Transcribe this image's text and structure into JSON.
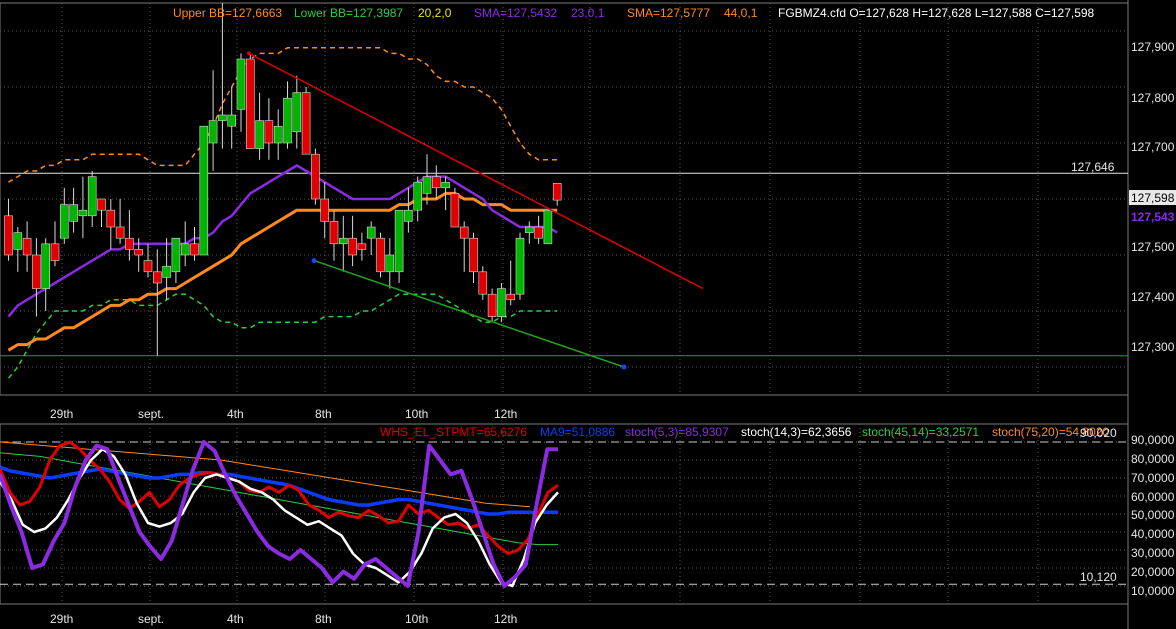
{
  "instrument": "FGBMZ4.cfd",
  "colors": {
    "background": "#000000",
    "grid": "#5a5a5a",
    "bull_candle": "#00b400",
    "bear_candle": "#e00000",
    "upper_bb": "#ff8a1e",
    "lower_bb": "#2ecc40",
    "sma23": "#8a2be2",
    "sma44": "#ff8a1e",
    "trendline_down": "#e00000",
    "trendline_support": "#1fa31f",
    "horizontal_level": "#1fa31f",
    "whs": "#e00000",
    "ma9": "#0a3cff",
    "stoch53": "#8a2be2",
    "stoch143": "#ffffff",
    "stoch4514": "#2ecc40",
    "stoch7520": "#ff8a1e"
  },
  "price_panel": {
    "legend": {
      "upper_bb": "Upper BB=127,6663",
      "lower_bb": "Lower BB=127,3987",
      "bb_params": "20,2,0",
      "sma1": "SMA=127,5432",
      "sma1_params": "23,0,1",
      "sma2": "SMA=127,5777",
      "sma2_params": "44,0,1",
      "ohlc": "FGBMZ4.cfd O=127,628 H=127,628 L=127,588 C=127,598"
    },
    "axis_labels": [
      "127,900",
      "127,800",
      "127,700",
      "127,500",
      "127,400",
      "127,300"
    ],
    "level_label": "127,646",
    "last_price_label": "127,598",
    "sma_price_label": "127,543"
  },
  "date_axis": [
    "29th",
    "sept.",
    "4th",
    "8th",
    "10th",
    "12th"
  ],
  "indicator_panel": {
    "legend": {
      "whs": "WHS_EL_STPMT=65,6276",
      "ma9": "MA9=51,0886",
      "stoch53": "stoch(5,3)=85,9307",
      "stoch143": "stoch(14,3)=62,3656",
      "stoch4514": "stoch(45,14)=33,2571",
      "stoch7520": "stoch(75,20)=54,8020"
    },
    "axis_labels": [
      "90,0000",
      "80,0000",
      "70,0000",
      "60,0000",
      "50,0000",
      "40,0000",
      "30,0000",
      "20,0000",
      "10,0000"
    ],
    "upper_level": "90,020",
    "lower_level": "10,120"
  },
  "chart_data": {
    "type": "candlestick",
    "y_range": [
      127.25,
      127.95
    ],
    "candles": [
      {
        "o": 127.57,
        "h": 127.6,
        "l": 127.49,
        "c": 127.5
      },
      {
        "o": 127.51,
        "h": 127.55,
        "l": 127.47,
        "c": 127.54
      },
      {
        "o": 127.53,
        "h": 127.56,
        "l": 127.47,
        "c": 127.5
      },
      {
        "o": 127.5,
        "h": 127.53,
        "l": 127.39,
        "c": 127.44
      },
      {
        "o": 127.44,
        "h": 127.53,
        "l": 127.4,
        "c": 127.52
      },
      {
        "o": 127.52,
        "h": 127.56,
        "l": 127.48,
        "c": 127.49
      },
      {
        "o": 127.53,
        "h": 127.62,
        "l": 127.52,
        "c": 127.59
      },
      {
        "o": 127.56,
        "h": 127.62,
        "l": 127.54,
        "c": 127.59
      },
      {
        "o": 127.57,
        "h": 127.64,
        "l": 127.53,
        "c": 127.58
      },
      {
        "o": 127.57,
        "h": 127.65,
        "l": 127.55,
        "c": 127.64
      },
      {
        "o": 127.6,
        "h": 127.6,
        "l": 127.55,
        "c": 127.58
      },
      {
        "o": 127.58,
        "h": 127.6,
        "l": 127.51,
        "c": 127.55
      },
      {
        "o": 127.55,
        "h": 127.6,
        "l": 127.52,
        "c": 127.53
      },
      {
        "o": 127.53,
        "h": 127.58,
        "l": 127.49,
        "c": 127.51
      },
      {
        "o": 127.51,
        "h": 127.53,
        "l": 127.47,
        "c": 127.5
      },
      {
        "o": 127.49,
        "h": 127.52,
        "l": 127.46,
        "c": 127.47
      },
      {
        "o": 127.47,
        "h": 127.51,
        "l": 127.32,
        "c": 127.45
      },
      {
        "o": 127.46,
        "h": 127.53,
        "l": 127.42,
        "c": 127.48
      },
      {
        "o": 127.47,
        "h": 127.53,
        "l": 127.45,
        "c": 127.53
      },
      {
        "o": 127.5,
        "h": 127.56,
        "l": 127.48,
        "c": 127.52
      },
      {
        "o": 127.52,
        "h": 127.55,
        "l": 127.49,
        "c": 127.5
      },
      {
        "o": 127.5,
        "h": 127.73,
        "l": 127.5,
        "c": 127.73
      },
      {
        "o": 127.7,
        "h": 127.83,
        "l": 127.65,
        "c": 127.74
      },
      {
        "o": 127.74,
        "h": 127.95,
        "l": 127.69,
        "c": 127.75
      },
      {
        "o": 127.73,
        "h": 127.8,
        "l": 127.69,
        "c": 127.75
      },
      {
        "o": 127.76,
        "h": 127.86,
        "l": 127.72,
        "c": 127.85
      },
      {
        "o": 127.85,
        "h": 127.86,
        "l": 127.74,
        "c": 127.69
      },
      {
        "o": 127.69,
        "h": 127.79,
        "l": 127.67,
        "c": 127.74
      },
      {
        "o": 127.74,
        "h": 127.78,
        "l": 127.67,
        "c": 127.7
      },
      {
        "o": 127.7,
        "h": 127.76,
        "l": 127.67,
        "c": 127.73
      },
      {
        "o": 127.7,
        "h": 127.81,
        "l": 127.69,
        "c": 127.78
      },
      {
        "o": 127.72,
        "h": 127.82,
        "l": 127.69,
        "c": 127.79
      },
      {
        "o": 127.79,
        "h": 127.8,
        "l": 127.68,
        "c": 127.68
      },
      {
        "o": 127.68,
        "h": 127.69,
        "l": 127.59,
        "c": 127.6
      },
      {
        "o": 127.6,
        "h": 127.63,
        "l": 127.53,
        "c": 127.56
      },
      {
        "o": 127.56,
        "h": 127.58,
        "l": 127.49,
        "c": 127.52
      },
      {
        "o": 127.52,
        "h": 127.57,
        "l": 127.47,
        "c": 127.53
      },
      {
        "o": 127.53,
        "h": 127.57,
        "l": 127.48,
        "c": 127.5
      },
      {
        "o": 127.52,
        "h": 127.54,
        "l": 127.49,
        "c": 127.51
      },
      {
        "o": 127.53,
        "h": 127.56,
        "l": 127.5,
        "c": 127.55
      },
      {
        "o": 127.53,
        "h": 127.54,
        "l": 127.46,
        "c": 127.47
      },
      {
        "o": 127.47,
        "h": 127.53,
        "l": 127.44,
        "c": 127.5
      },
      {
        "o": 127.47,
        "h": 127.58,
        "l": 127.45,
        "c": 127.58
      },
      {
        "o": 127.56,
        "h": 127.62,
        "l": 127.54,
        "c": 127.58
      },
      {
        "o": 127.58,
        "h": 127.64,
        "l": 127.56,
        "c": 127.63
      },
      {
        "o": 127.61,
        "h": 127.68,
        "l": 127.59,
        "c": 127.64
      },
      {
        "o": 127.64,
        "h": 127.66,
        "l": 127.6,
        "c": 127.62
      },
      {
        "o": 127.62,
        "h": 127.64,
        "l": 127.58,
        "c": 127.63
      },
      {
        "o": 127.61,
        "h": 127.62,
        "l": 127.55,
        "c": 127.55
      },
      {
        "o": 127.55,
        "h": 127.56,
        "l": 127.47,
        "c": 127.53
      },
      {
        "o": 127.53,
        "h": 127.54,
        "l": 127.45,
        "c": 127.47
      },
      {
        "o": 127.47,
        "h": 127.48,
        "l": 127.42,
        "c": 127.43
      },
      {
        "o": 127.43,
        "h": 127.44,
        "l": 127.38,
        "c": 127.39
      },
      {
        "o": 127.39,
        "h": 127.45,
        "l": 127.38,
        "c": 127.44
      },
      {
        "o": 127.43,
        "h": 127.49,
        "l": 127.41,
        "c": 127.42
      },
      {
        "o": 127.43,
        "h": 127.54,
        "l": 127.42,
        "c": 127.53
      },
      {
        "o": 127.54,
        "h": 127.56,
        "l": 127.52,
        "c": 127.55
      },
      {
        "o": 127.55,
        "h": 127.57,
        "l": 127.52,
        "c": 127.53
      },
      {
        "o": 127.52,
        "h": 127.58,
        "l": 127.52,
        "c": 127.58
      },
      {
        "o": 127.628,
        "h": 127.628,
        "l": 127.588,
        "c": 127.598
      }
    ],
    "sma23": [
      127.39,
      127.41,
      127.42,
      127.43,
      127.44,
      127.45,
      127.46,
      127.47,
      127.48,
      127.49,
      127.5,
      127.51,
      127.51,
      127.52,
      127.52,
      127.52,
      127.52,
      127.52,
      127.52,
      127.52,
      127.53,
      127.53,
      127.54,
      127.56,
      127.57,
      127.59,
      127.61,
      127.62,
      127.63,
      127.64,
      127.65,
      127.66,
      127.65,
      127.64,
      127.63,
      127.62,
      127.61,
      127.6,
      127.6,
      127.6,
      127.6,
      127.6,
      127.61,
      127.62,
      127.63,
      127.64,
      127.64,
      127.64,
      127.63,
      127.62,
      127.61,
      127.6,
      127.58,
      127.57,
      127.56,
      127.55,
      127.55,
      127.55,
      127.55,
      127.54
    ],
    "sma44": [
      127.33,
      127.34,
      127.34,
      127.35,
      127.35,
      127.36,
      127.37,
      127.37,
      127.38,
      127.39,
      127.4,
      127.41,
      127.41,
      127.42,
      127.42,
      127.43,
      127.43,
      127.44,
      127.44,
      127.45,
      127.46,
      127.47,
      127.48,
      127.49,
      127.5,
      127.52,
      127.53,
      127.54,
      127.55,
      127.56,
      127.57,
      127.58,
      127.58,
      127.58,
      127.58,
      127.58,
      127.58,
      127.58,
      127.58,
      127.58,
      127.58,
      127.58,
      127.59,
      127.59,
      127.6,
      127.6,
      127.6,
      127.61,
      127.61,
      127.6,
      127.6,
      127.59,
      127.59,
      127.59,
      127.58,
      127.58,
      127.58,
      127.58,
      127.58,
      127.58
    ],
    "upper_bb": [
      127.63,
      127.64,
      127.65,
      127.65,
      127.66,
      127.66,
      127.67,
      127.67,
      127.67,
      127.68,
      127.68,
      127.68,
      127.68,
      127.68,
      127.68,
      127.67,
      127.66,
      127.66,
      127.66,
      127.66,
      127.68,
      127.7,
      127.73,
      127.77,
      127.8,
      127.83,
      127.85,
      127.86,
      127.86,
      127.86,
      127.87,
      127.87,
      127.87,
      127.87,
      127.87,
      127.87,
      127.87,
      127.87,
      127.87,
      127.87,
      127.87,
      127.86,
      127.86,
      127.85,
      127.85,
      127.84,
      127.82,
      127.81,
      127.81,
      127.8,
      127.8,
      127.79,
      127.78,
      127.76,
      127.73,
      127.7,
      127.68,
      127.67,
      127.67,
      127.67
    ],
    "lower_bb": [
      127.28,
      127.3,
      127.33,
      127.36,
      127.38,
      127.4,
      127.4,
      127.4,
      127.4,
      127.41,
      127.41,
      127.42,
      127.42,
      127.42,
      127.41,
      127.41,
      127.41,
      127.42,
      127.43,
      127.43,
      127.42,
      127.41,
      127.39,
      127.38,
      127.38,
      127.37,
      127.37,
      127.38,
      127.38,
      127.38,
      127.38,
      127.38,
      127.38,
      127.38,
      127.39,
      127.39,
      127.39,
      127.39,
      127.4,
      127.4,
      127.41,
      127.42,
      127.43,
      127.43,
      127.43,
      127.43,
      127.43,
      127.42,
      127.41,
      127.4,
      127.39,
      127.38,
      127.38,
      127.39,
      127.39,
      127.4,
      127.4,
      127.4,
      127.4,
      127.4
    ],
    "trendline_down": [
      [
        127.86,
        127.44
      ]
    ],
    "trendline_support": [
      [
        127.49,
        127.3
      ]
    ],
    "horizontal_levels": [
      127.646,
      127.32
    ],
    "indicator_y_range": [
      0,
      100
    ],
    "whs": [
      75,
      62,
      55,
      57,
      65,
      80,
      88,
      90,
      86,
      80,
      75,
      68,
      58,
      53,
      57,
      62,
      54,
      58,
      66,
      70,
      72,
      73,
      72,
      70,
      68,
      63,
      62,
      65,
      62,
      66,
      63,
      55,
      52,
      48,
      51,
      49,
      48,
      52,
      49,
      45,
      46,
      55,
      50,
      52,
      48,
      44,
      45,
      42,
      44,
      38,
      32,
      28,
      30,
      36,
      50,
      62,
      66
    ],
    "ma9": [
      76,
      74,
      73,
      72,
      71,
      70,
      71,
      72,
      73,
      74,
      75,
      74,
      73,
      72,
      71,
      70,
      70,
      71,
      72,
      72,
      73,
      73,
      72,
      72,
      71,
      70,
      69,
      68,
      67,
      66,
      64,
      62,
      60,
      58,
      57,
      56,
      55,
      55,
      56,
      57,
      58,
      58,
      57,
      56,
      55,
      54,
      53,
      52,
      51,
      50,
      50,
      51,
      51,
      51,
      51,
      51,
      51
    ],
    "stoch53": [
      72,
      55,
      40,
      20,
      22,
      35,
      45,
      65,
      80,
      88,
      86,
      70,
      55,
      40,
      32,
      25,
      35,
      55,
      75,
      90,
      85,
      72,
      60,
      50,
      40,
      32,
      28,
      25,
      30,
      25,
      20,
      12,
      18,
      14,
      22,
      25,
      20,
      15,
      10,
      40,
      88,
      80,
      72,
      74,
      58,
      40,
      22,
      10,
      15,
      22,
      55,
      86,
      86
    ],
    "stoch143": [
      68,
      58,
      44,
      40,
      42,
      48,
      58,
      70,
      80,
      86,
      82,
      72,
      56,
      45,
      43,
      45,
      50,
      62,
      70,
      72,
      70,
      68,
      64,
      62,
      58,
      52,
      48,
      44,
      46,
      42,
      38,
      28,
      22,
      20,
      16,
      12,
      18,
      28,
      42,
      48,
      50,
      45,
      35,
      22,
      12,
      10,
      25,
      45,
      55,
      62
    ],
    "stoch4514": [
      84,
      83,
      82,
      80,
      78,
      76,
      74,
      72,
      70,
      68,
      66,
      64,
      62,
      60,
      58,
      56,
      54,
      52,
      50,
      48,
      46,
      44,
      42,
      40,
      38,
      36,
      34,
      33,
      33
    ],
    "stoch7520": [
      90,
      89,
      88,
      87,
      86,
      85,
      84,
      83,
      82,
      81,
      80,
      78,
      76,
      74,
      72,
      70,
      68,
      66,
      64,
      62,
      60,
      58,
      56,
      55,
      54
    ]
  }
}
